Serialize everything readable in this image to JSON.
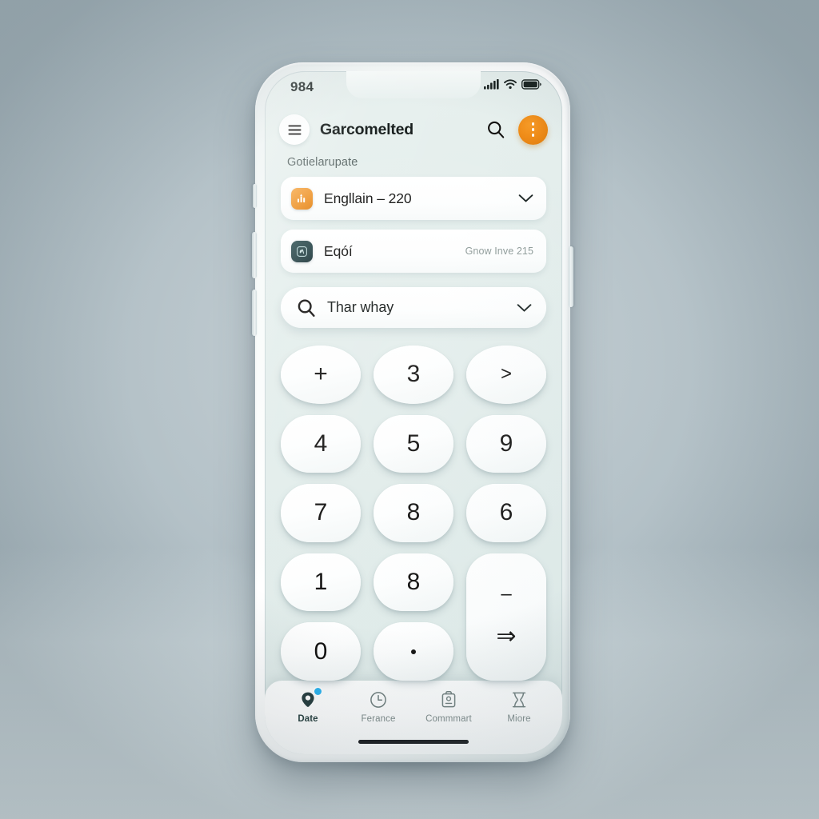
{
  "status_bar": {
    "time": "984",
    "icons": [
      "signal-bars-icon",
      "wifi-icon",
      "battery-icon"
    ]
  },
  "app_bar": {
    "menu_icon": "hamburger-menu-icon",
    "title": "Garcomelted",
    "search_icon": "search-icon",
    "overflow_icon": "more-vertical-icon",
    "accent_color": "#ef8a15"
  },
  "section": {
    "label": "Gotielarupate"
  },
  "rows": [
    {
      "icon": "chart-badge-icon",
      "icon_color": "#ec8c1d",
      "label": "Engllain – 220",
      "meta": "",
      "trailing_icon": "chevron-down-icon"
    },
    {
      "icon": "app-tile-icon",
      "icon_color": "#1f3c40",
      "label": "Eqóí",
      "meta": "Gnow Inve 215",
      "trailing_icon": ""
    }
  ],
  "search": {
    "icon": "search-icon",
    "value": "Thar whay",
    "placeholder": "Thar whay",
    "trailing_icon": "chevron-down-icon"
  },
  "keypad": {
    "keys": [
      {
        "label": "+",
        "shape": "round",
        "name": "key-plus"
      },
      {
        "label": "3",
        "shape": "round",
        "name": "key-3"
      },
      {
        "label": ">",
        "shape": "round",
        "name": "key-greater-than"
      },
      {
        "label": "4",
        "shape": "pill",
        "name": "key-4"
      },
      {
        "label": "5",
        "shape": "pill",
        "name": "key-5"
      },
      {
        "label": "9",
        "shape": "pill",
        "name": "key-9"
      },
      {
        "label": "7",
        "shape": "pill",
        "name": "key-7"
      },
      {
        "label": "8",
        "shape": "pill",
        "name": "key-8"
      },
      {
        "label": "6",
        "shape": "pill",
        "name": "key-6"
      },
      {
        "label": "1",
        "shape": "pill",
        "name": "key-1"
      },
      {
        "label": "8",
        "shape": "pill",
        "name": "key-8-second"
      },
      {
        "label": "0",
        "shape": "pill",
        "name": "key-0"
      },
      {
        "label": "·",
        "shape": "pill",
        "name": "key-decimal"
      }
    ],
    "tall_key": {
      "top_label": "–",
      "bottom_label": "⇒",
      "name": "key-minus-enter"
    }
  },
  "bottom_nav": [
    {
      "label": "Date",
      "icon": "location-pin-filled-icon",
      "badge": true,
      "active": true
    },
    {
      "label": "Ferance",
      "icon": "clock-icon",
      "badge": false,
      "active": false
    },
    {
      "label": "Commmart",
      "icon": "clipboard-icon",
      "badge": false,
      "active": false
    },
    {
      "label": "Miore",
      "icon": "hourglass-icon",
      "badge": false,
      "active": false
    }
  ],
  "home_indicator": "home-bar"
}
